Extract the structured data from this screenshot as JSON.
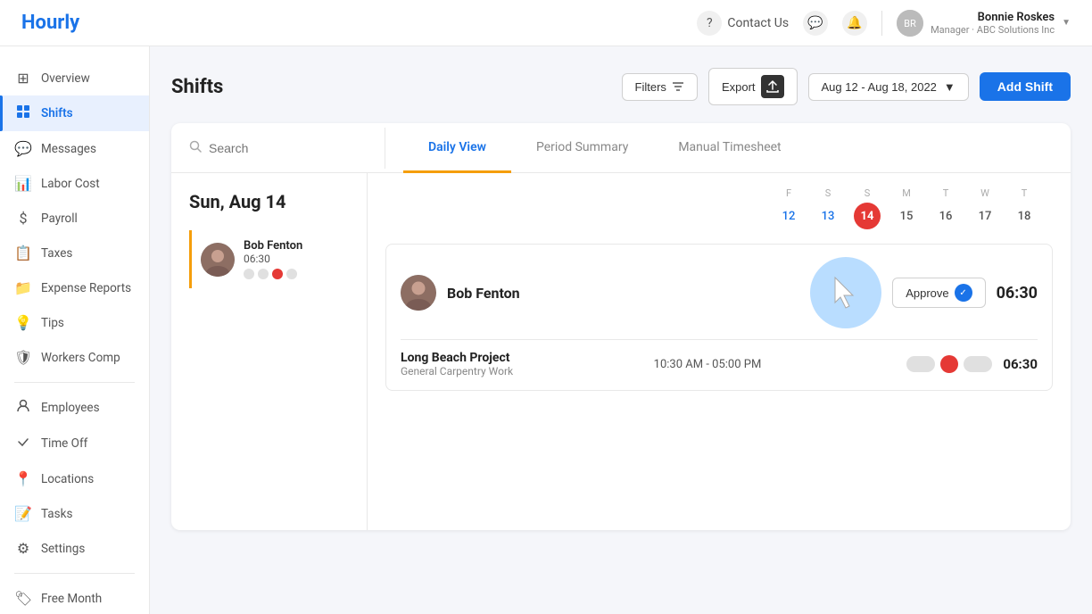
{
  "app": {
    "logo": "Hourly"
  },
  "topNav": {
    "contact_label": "Contact Us",
    "user_name": "Bonnie Roskes",
    "user_role": "Manager · ABC Solutions Inc",
    "user_initials": "BR"
  },
  "sidebar": {
    "items": [
      {
        "id": "overview",
        "label": "Overview",
        "icon": "⊞"
      },
      {
        "id": "shifts",
        "label": "Shifts",
        "icon": "▦"
      },
      {
        "id": "messages",
        "label": "Messages",
        "icon": "💬"
      },
      {
        "id": "labor-cost",
        "label": "Labor Cost",
        "icon": "📊"
      },
      {
        "id": "payroll",
        "label": "Payroll",
        "icon": "💲"
      },
      {
        "id": "taxes",
        "label": "Taxes",
        "icon": "📋"
      },
      {
        "id": "expense-reports",
        "label": "Expense Reports",
        "icon": "📁"
      },
      {
        "id": "tips",
        "label": "Tips",
        "icon": "💡"
      },
      {
        "id": "workers-comp",
        "label": "Workers Comp",
        "icon": "🛡"
      },
      {
        "id": "employees",
        "label": "Employees",
        "icon": "👤"
      },
      {
        "id": "time-off",
        "label": "Time Off",
        "icon": "➤"
      },
      {
        "id": "locations",
        "label": "Locations",
        "icon": "📍"
      },
      {
        "id": "tasks",
        "label": "Tasks",
        "icon": "📝"
      },
      {
        "id": "settings",
        "label": "Settings",
        "icon": "⚙"
      },
      {
        "id": "free-month",
        "label": "Free Month",
        "icon": "🏷"
      }
    ]
  },
  "page": {
    "title": "Shifts"
  },
  "header_actions": {
    "filters_label": "Filters",
    "export_label": "Export",
    "date_range": "Aug 12 - Aug 18, 2022",
    "add_shift_label": "Add Shift"
  },
  "tabs": [
    {
      "id": "daily-view",
      "label": "Daily View",
      "active": true
    },
    {
      "id": "period-summary",
      "label": "Period Summary",
      "active": false
    },
    {
      "id": "manual-timesheet",
      "label": "Manual Timesheet",
      "active": false
    }
  ],
  "search": {
    "placeholder": "Search"
  },
  "daily_view": {
    "date_heading": "Sun, Aug 14",
    "week_days": [
      {
        "label": "F",
        "num": "12",
        "style": "blue"
      },
      {
        "label": "S",
        "num": "13",
        "style": "blue"
      },
      {
        "label": "S",
        "num": "14",
        "style": "today"
      },
      {
        "label": "M",
        "num": "15",
        "style": "normal"
      },
      {
        "label": "T",
        "num": "16",
        "style": "normal"
      },
      {
        "label": "W",
        "num": "17",
        "style": "normal"
      },
      {
        "label": "T",
        "num": "18",
        "style": "normal"
      }
    ]
  },
  "employee_list": [
    {
      "name": "Bob Fenton",
      "time": "06:30",
      "dots": [
        "grey",
        "grey",
        "red",
        "grey"
      ]
    }
  ],
  "shift_card": {
    "employee_name": "Bob Fenton",
    "total_time": "06:30",
    "approve_label": "Approve",
    "project_name": "Long Beach Project",
    "project_sub": "General Carpentry Work",
    "time_range": "10:30 AM - 05:00 PM",
    "detail_total": "06:30"
  }
}
